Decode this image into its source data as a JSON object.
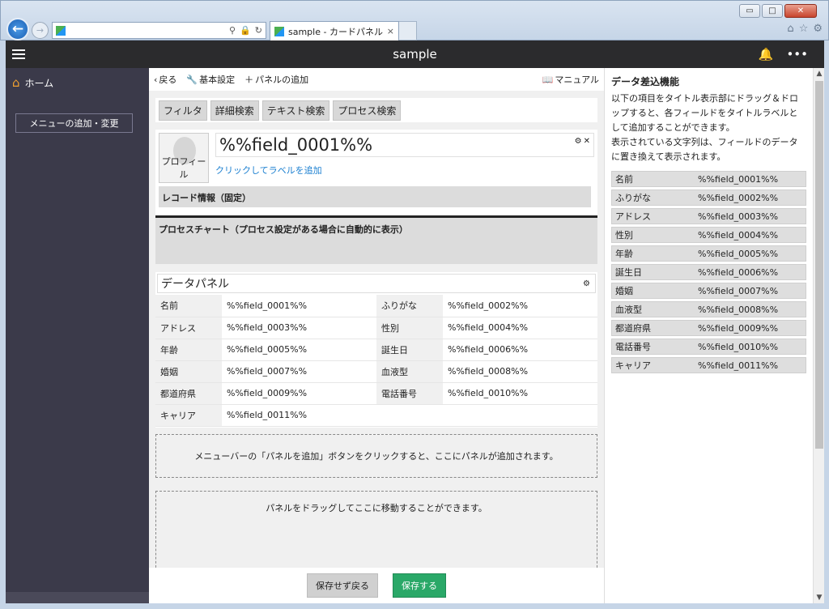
{
  "browser": {
    "tab_title": "sample - カードパネル編...",
    "win_ctrls": {
      "minimize": "▭",
      "maximize": "□",
      "close": "✕"
    }
  },
  "app": {
    "title": "sample"
  },
  "sidebar": {
    "home_label": "ホーム",
    "menu_add_label": "メニューの追加・変更"
  },
  "toolbar": {
    "back_label": "戻る",
    "basic_settings_label": "基本設定",
    "add_panel_label": "パネルの追加",
    "manual_label": "マニュアル"
  },
  "search_tabs": [
    "フィルタ",
    "詳細検索",
    "テキスト検索",
    "プロセス検索"
  ],
  "card": {
    "avatar_label": "プロフィール",
    "title_field": "%%field_0001%%",
    "label_link": "クリックしてラベルを追加",
    "record_info": "レコード情報（固定）",
    "process_chart": "プロセスチャート（プロセス設定がある場合に自動的に表示）"
  },
  "data_panel": {
    "title": "データパネル",
    "rows": [
      {
        "l1": "名前",
        "v1": "%%field_0001%%",
        "l2": "ふりがな",
        "v2": "%%field_0002%%"
      },
      {
        "l1": "アドレス",
        "v1": "%%field_0003%%",
        "l2": "性別",
        "v2": "%%field_0004%%"
      },
      {
        "l1": "年齢",
        "v1": "%%field_0005%%",
        "l2": "誕生日",
        "v2": "%%field_0006%%"
      },
      {
        "l1": "婚姻",
        "v1": "%%field_0007%%",
        "l2": "血液型",
        "v2": "%%field_0008%%"
      },
      {
        "l1": "都道府県",
        "v1": "%%field_0009%%",
        "l2": "電話番号",
        "v2": "%%field_0010%%"
      },
      {
        "l1": "キャリア",
        "v1": "%%field_0011%%",
        "l2": "",
        "v2": ""
      }
    ]
  },
  "drop_zones": {
    "add_hint": "メニューバーの「パネルを追加」ボタンをクリックすると、ここにパネルが追加されます。",
    "move_hint": "パネルをドラッグしてここに移動することができます。"
  },
  "buttons": {
    "cancel": "保存せず戻る",
    "save": "保存する"
  },
  "right_panel": {
    "title": "データ差込機能",
    "desc1": "以下の項目をタイトル表示部にドラッグ＆ドロップすると、各フィールドをタイトルラベルとして追加することができます。",
    "desc2": "表示されている文字列は、フィールドのデータに置き換えて表示されます。",
    "fields": [
      {
        "k": "名前",
        "v": "%%field_0001%%"
      },
      {
        "k": "ふりがな",
        "v": "%%field_0002%%"
      },
      {
        "k": "アドレス",
        "v": "%%field_0003%%"
      },
      {
        "k": "性別",
        "v": "%%field_0004%%"
      },
      {
        "k": "年齢",
        "v": "%%field_0005%%"
      },
      {
        "k": "誕生日",
        "v": "%%field_0006%%"
      },
      {
        "k": "婚姻",
        "v": "%%field_0007%%"
      },
      {
        "k": "血液型",
        "v": "%%field_0008%%"
      },
      {
        "k": "都道府県",
        "v": "%%field_0009%%"
      },
      {
        "k": "電話番号",
        "v": "%%field_0010%%"
      },
      {
        "k": "キャリア",
        "v": "%%field_0011%%"
      }
    ]
  },
  "colors": {
    "header_bg": "#2b2b2d",
    "sidebar_bg": "#3b3a4a",
    "save_green": "#2aa868",
    "link_blue": "#1a7fd0"
  }
}
